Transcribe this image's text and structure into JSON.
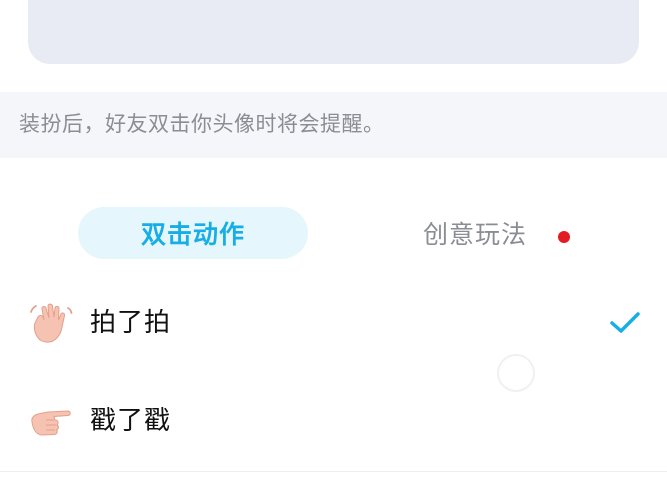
{
  "hint": {
    "text": "装扮后，好友双击你头像时将会提醒。"
  },
  "tabs": [
    {
      "label": "双击动作",
      "active": true
    },
    {
      "label": "创意玩法",
      "active": false,
      "has_red_dot": true
    }
  ],
  "actions": [
    {
      "label": "拍了拍",
      "icon": "waving-hand-icon",
      "selected": true
    },
    {
      "label": "戳了戳",
      "icon": "pointing-hand-icon",
      "selected": false
    }
  ],
  "colors": {
    "accent": "#17aee6",
    "accent_bg": "#e6f6fd",
    "red_dot": "#e31b23",
    "hint_bg": "#f5f6fa",
    "preview_bg": "#e9ebf4"
  }
}
